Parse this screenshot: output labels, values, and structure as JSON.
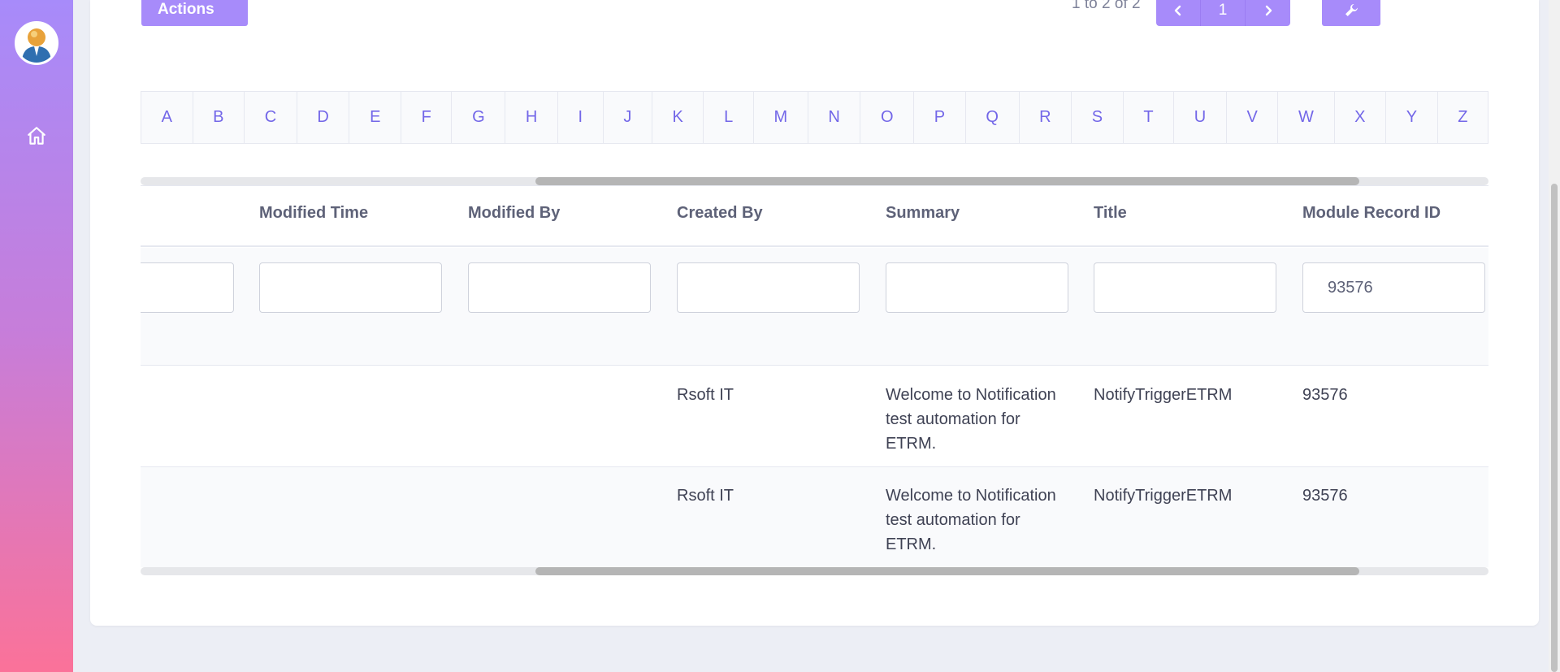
{
  "header": {
    "actions_label": "Actions",
    "pager_info": "1 to 2 of 2",
    "page_number": "1"
  },
  "icons": {
    "prev": "chevron-left-icon",
    "next": "chevron-right-icon",
    "tool": "wrench-icon",
    "home": "home-icon"
  },
  "colors": {
    "accent": "#a78bfa",
    "sidebar_top": "#a78bfa",
    "sidebar_bottom": "#fb7299",
    "letter": "#7367e8"
  },
  "alphabet": [
    "A",
    "B",
    "C",
    "D",
    "E",
    "F",
    "G",
    "H",
    "I",
    "J",
    "K",
    "L",
    "M",
    "N",
    "O",
    "P",
    "Q",
    "R",
    "S",
    "T",
    "U",
    "V",
    "W",
    "X",
    "Y",
    "Z"
  ],
  "table": {
    "columns": [
      "Modified Time",
      "Modified By",
      "Created By",
      "Summary",
      "Title",
      "Module Record ID"
    ],
    "filters": {
      "module_record_id": "93576"
    },
    "rows": [
      {
        "modified_time": "",
        "modified_by": "",
        "created_by": "Rsoft IT",
        "summary": "Welcome to Notification test automation for ETRM.",
        "title": "NotifyTriggerETRM",
        "module_record_id": "93576"
      },
      {
        "modified_time": "",
        "modified_by": "",
        "created_by": "Rsoft IT",
        "summary": "Welcome to Notification test automation for ETRM.",
        "title": "NotifyTriggerETRM",
        "module_record_id": "93576"
      }
    ]
  }
}
